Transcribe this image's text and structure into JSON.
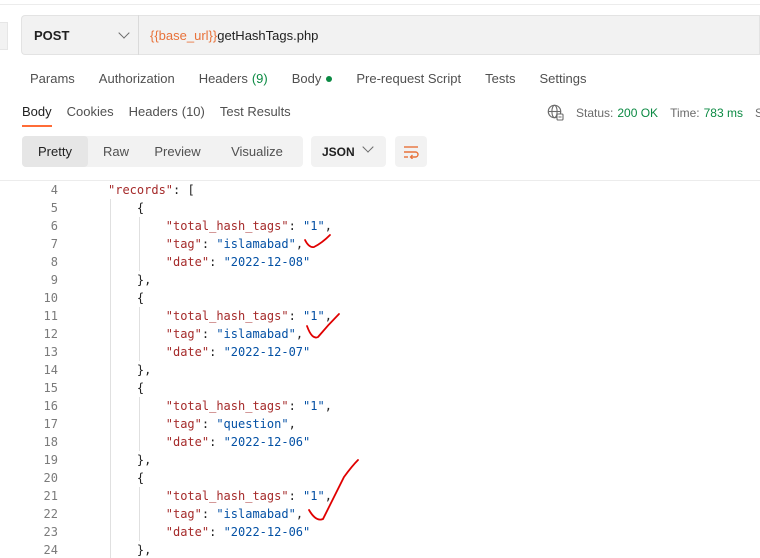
{
  "request": {
    "method": "POST",
    "url_var": "{{base_url}}",
    "url_path": "getHashTags.php"
  },
  "request_tabs": [
    {
      "label": "Params"
    },
    {
      "label": "Authorization"
    },
    {
      "label": "Headers",
      "count": "(9)"
    },
    {
      "label": "Body",
      "dot": true
    },
    {
      "label": "Pre-request Script"
    },
    {
      "label": "Tests"
    },
    {
      "label": "Settings"
    }
  ],
  "response_tabs": [
    {
      "label": "Body",
      "active": true
    },
    {
      "label": "Cookies"
    },
    {
      "label": "Headers",
      "count": "(10)"
    },
    {
      "label": "Test Results"
    }
  ],
  "status": {
    "status_label": "Status:",
    "status_value": "200 OK",
    "time_label": "Time:",
    "time_value": "783 ms",
    "size_label": "Si"
  },
  "view_modes": {
    "pretty": "Pretty",
    "raw": "Raw",
    "preview": "Preview",
    "visualize": "Visualize",
    "active": "pretty"
  },
  "format": "JSON",
  "icons": {
    "globe": "globe-icon",
    "wrap": "wrap-lines-icon",
    "chevron": "chevron-down-icon"
  },
  "colors": {
    "accent": "#ff6c37",
    "url_variable": "#e8723a",
    "success": "#0b8a43",
    "json_key": "#a52a2a",
    "json_string": "#0451a5",
    "annotation": "#e00000"
  },
  "code_lines": [
    {
      "n": "4",
      "indent": 0,
      "parts": [
        {
          "t": "key",
          "v": "\"records\""
        },
        {
          "t": "punc",
          "v": ": ["
        }
      ]
    },
    {
      "n": "5",
      "indent": 1,
      "parts": [
        {
          "t": "punc",
          "v": "{"
        }
      ]
    },
    {
      "n": "6",
      "indent": 2,
      "parts": [
        {
          "t": "key",
          "v": "\"total_hash_tags\""
        },
        {
          "t": "punc",
          "v": ": "
        },
        {
          "t": "str",
          "v": "\"1\""
        },
        {
          "t": "punc",
          "v": ","
        }
      ]
    },
    {
      "n": "7",
      "indent": 2,
      "parts": [
        {
          "t": "key",
          "v": "\"tag\""
        },
        {
          "t": "punc",
          "v": ": "
        },
        {
          "t": "str",
          "v": "\"islamabad\""
        },
        {
          "t": "punc",
          "v": ","
        }
      ]
    },
    {
      "n": "8",
      "indent": 2,
      "parts": [
        {
          "t": "key",
          "v": "\"date\""
        },
        {
          "t": "punc",
          "v": ": "
        },
        {
          "t": "str",
          "v": "\"2022-12-08\""
        }
      ]
    },
    {
      "n": "9",
      "indent": 1,
      "parts": [
        {
          "t": "punc",
          "v": "},"
        }
      ]
    },
    {
      "n": "10",
      "indent": 1,
      "parts": [
        {
          "t": "punc",
          "v": "{"
        }
      ]
    },
    {
      "n": "11",
      "indent": 2,
      "parts": [
        {
          "t": "key",
          "v": "\"total_hash_tags\""
        },
        {
          "t": "punc",
          "v": ": "
        },
        {
          "t": "str",
          "v": "\"1\""
        },
        {
          "t": "punc",
          "v": ","
        }
      ]
    },
    {
      "n": "12",
      "indent": 2,
      "parts": [
        {
          "t": "key",
          "v": "\"tag\""
        },
        {
          "t": "punc",
          "v": ": "
        },
        {
          "t": "str",
          "v": "\"islamabad\""
        },
        {
          "t": "punc",
          "v": ","
        }
      ]
    },
    {
      "n": "13",
      "indent": 2,
      "parts": [
        {
          "t": "key",
          "v": "\"date\""
        },
        {
          "t": "punc",
          "v": ": "
        },
        {
          "t": "str",
          "v": "\"2022-12-07\""
        }
      ]
    },
    {
      "n": "14",
      "indent": 1,
      "parts": [
        {
          "t": "punc",
          "v": "},"
        }
      ]
    },
    {
      "n": "15",
      "indent": 1,
      "parts": [
        {
          "t": "punc",
          "v": "{"
        }
      ]
    },
    {
      "n": "16",
      "indent": 2,
      "parts": [
        {
          "t": "key",
          "v": "\"total_hash_tags\""
        },
        {
          "t": "punc",
          "v": ": "
        },
        {
          "t": "str",
          "v": "\"1\""
        },
        {
          "t": "punc",
          "v": ","
        }
      ]
    },
    {
      "n": "17",
      "indent": 2,
      "parts": [
        {
          "t": "key",
          "v": "\"tag\""
        },
        {
          "t": "punc",
          "v": ": "
        },
        {
          "t": "str",
          "v": "\"question\""
        },
        {
          "t": "punc",
          "v": ","
        }
      ]
    },
    {
      "n": "18",
      "indent": 2,
      "parts": [
        {
          "t": "key",
          "v": "\"date\""
        },
        {
          "t": "punc",
          "v": ": "
        },
        {
          "t": "str",
          "v": "\"2022-12-06\""
        }
      ]
    },
    {
      "n": "19",
      "indent": 1,
      "parts": [
        {
          "t": "punc",
          "v": "},"
        }
      ]
    },
    {
      "n": "20",
      "indent": 1,
      "parts": [
        {
          "t": "punc",
          "v": "{"
        }
      ]
    },
    {
      "n": "21",
      "indent": 2,
      "parts": [
        {
          "t": "key",
          "v": "\"total_hash_tags\""
        },
        {
          "t": "punc",
          "v": ": "
        },
        {
          "t": "str",
          "v": "\"1\""
        },
        {
          "t": "punc",
          "v": ","
        }
      ]
    },
    {
      "n": "22",
      "indent": 2,
      "parts": [
        {
          "t": "key",
          "v": "\"tag\""
        },
        {
          "t": "punc",
          "v": ": "
        },
        {
          "t": "str",
          "v": "\"islamabad\""
        },
        {
          "t": "punc",
          "v": ","
        }
      ]
    },
    {
      "n": "23",
      "indent": 2,
      "parts": [
        {
          "t": "key",
          "v": "\"date\""
        },
        {
          "t": "punc",
          "v": ": "
        },
        {
          "t": "str",
          "v": "\"2022-12-06\""
        }
      ]
    },
    {
      "n": "24",
      "indent": 1,
      "parts": [
        {
          "t": "punc",
          "v": "},"
        }
      ]
    }
  ]
}
